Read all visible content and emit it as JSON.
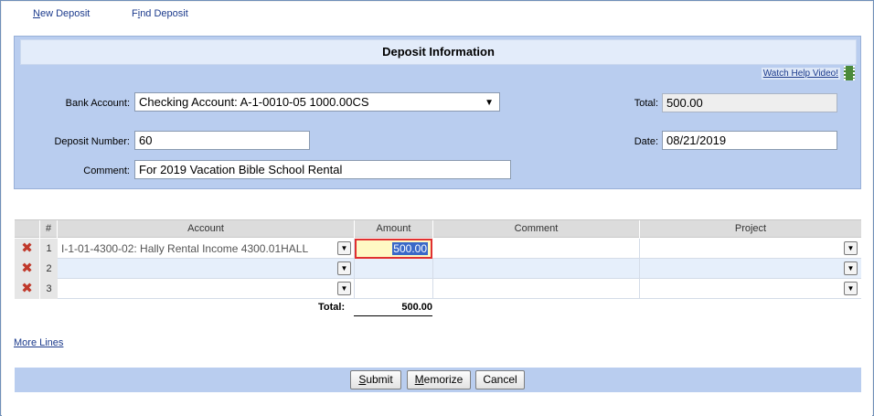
{
  "menu": {
    "new_deposit": {
      "accel": "N",
      "rest": "ew Deposit"
    },
    "find_deposit": {
      "pre": "F",
      "accel": "i",
      "rest": "nd Deposit"
    }
  },
  "panel": {
    "title": "Deposit Information",
    "help_link": "Watch Help Video!",
    "bank_account_label": "Bank Account:",
    "bank_account_value": "Checking Account: A-1-0010-05 1000.00CS",
    "total_label": "Total:",
    "total_value": "500.00",
    "deposit_number_label": "Deposit Number:",
    "deposit_number_value": "60",
    "date_label": "Date:",
    "date_value": "08/21/2019",
    "comment_label": "Comment:",
    "comment_value": "For 2019 Vacation Bible School Rental"
  },
  "grid": {
    "columns": [
      "#",
      "Account",
      "Amount",
      "Comment",
      "Project"
    ],
    "rows": [
      {
        "num": "1",
        "account": "I-1-01-4300-02: Hally Rental Income 4300.01HALL",
        "amount": "500.00",
        "comment": "",
        "project": ""
      },
      {
        "num": "2",
        "account": "",
        "amount": "",
        "comment": "",
        "project": ""
      },
      {
        "num": "3",
        "account": "",
        "amount": "",
        "comment": "",
        "project": ""
      }
    ],
    "total_label": "Total:",
    "total_value": "500.00"
  },
  "more_lines": "More Lines",
  "buttons": {
    "submit": {
      "accel": "S",
      "rest": "ubmit"
    },
    "memorize": {
      "accel": "M",
      "rest": "emorize"
    },
    "cancel": "Cancel"
  },
  "icons": {
    "delete": "delete-x-icon",
    "dropdown": "chevron-down-icon",
    "video": "film-icon"
  },
  "colors": {
    "panel_bg": "#b9cdef",
    "link": "#1b3a8c",
    "highlight_border": "#e03030",
    "delete_x": "#c0392b"
  }
}
